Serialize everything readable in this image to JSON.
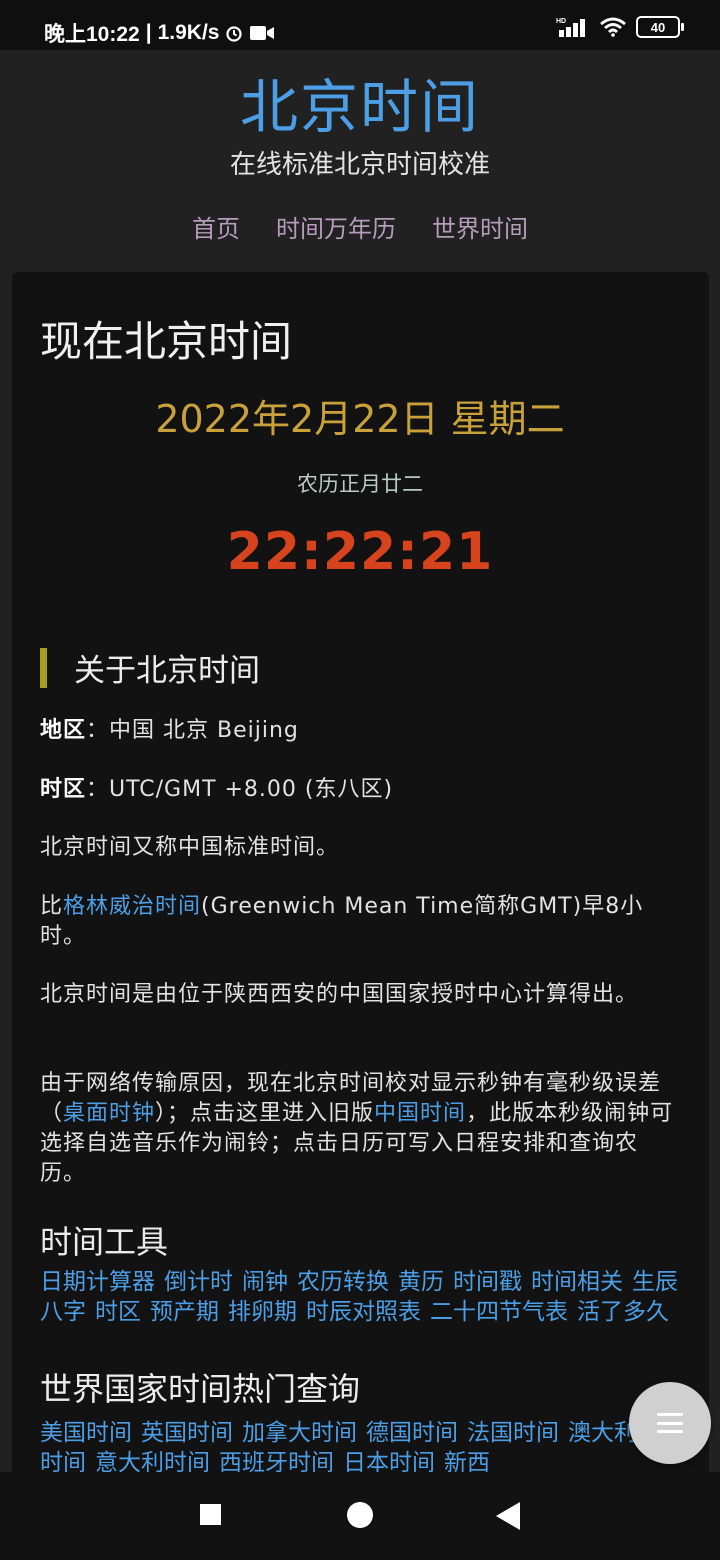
{
  "status_bar": {
    "time": "晚上10:22",
    "net_speed": "1.9K/s",
    "battery": "40"
  },
  "header": {
    "title": "北京时间",
    "subtitle": "在线标准北京时间校准",
    "nav": [
      "首页",
      "时间万年历",
      "世界时间"
    ]
  },
  "main": {
    "heading": "现在北京时间",
    "date": "2022年2月22日 星期二",
    "lunar": "农历正月廿二",
    "clock": "22:22:21",
    "about_title": "关于北京时间",
    "region_label": "地区",
    "region_value": "：中国 北京 Beijing",
    "tz_label": "时区",
    "tz_value": "：UTC/GMT +8.00 (东八区)",
    "para1": "北京时间又称中国标准时间。",
    "para2_pre": "比",
    "para2_link": "格林威治时间",
    "para2_post": "(Greenwich Mean Time简称GMT)早8小时。",
    "para3": "北京时间是由位于陕西西安的中国国家授时中心计算得出。",
    "para4_a": "由于网络传输原因，现在北京时间校对显示秒钟有毫秒级误差（",
    "para4_link1": "桌面时钟",
    "para4_b": "）；点击这里进入旧版",
    "para4_link2": "中国时间",
    "para4_c": "，此版本秒级闹钟可选择自选音乐作为闹铃；点击日历可写入日程安排和查询农历。",
    "tools_title": "时间工具",
    "tools": [
      "日期计算器",
      "倒计时",
      "闹钟",
      "农历转换",
      "黄历",
      "时间戳",
      "时间相关",
      "生辰八字",
      "时区",
      "预产期",
      "排卵期",
      "时辰对照表",
      "二十四节气表",
      "活了多久"
    ],
    "world_title": "世界国家时间热门查询",
    "world": [
      "美国时间",
      "英国时间",
      "加拿大时间",
      "德国时间",
      "法国时间",
      "澳大利亚时间",
      "意大利时间",
      "西班牙时间",
      "日本时间",
      "新西"
    ]
  }
}
